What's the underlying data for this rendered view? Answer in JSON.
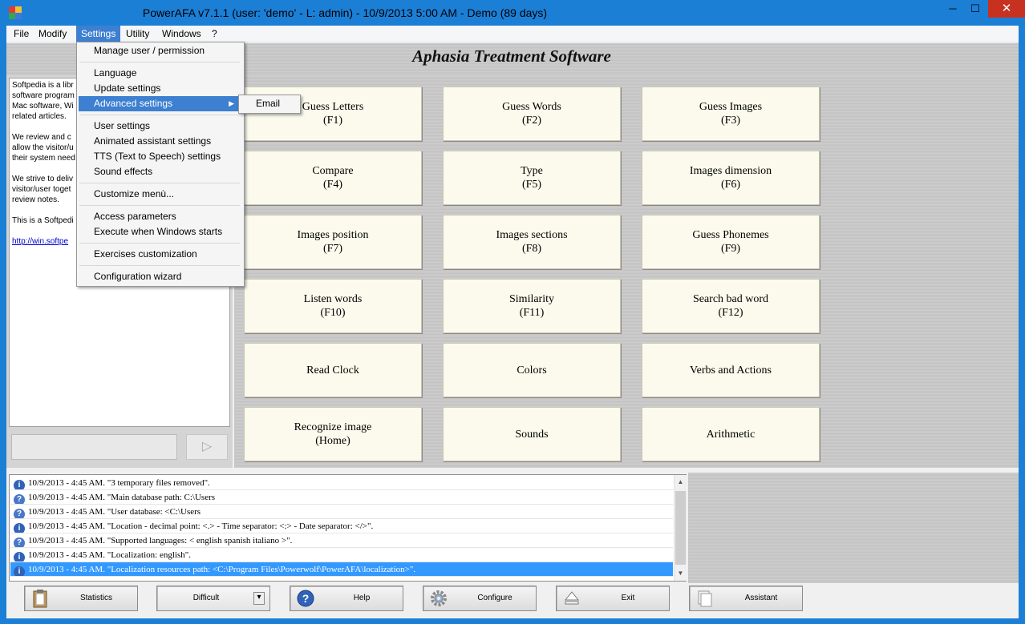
{
  "window": {
    "title": "PowerAFA v7.1.1  (user: 'demo'  - L: admin) - 10/9/2013 5:00 AM - Demo (89 days)",
    "minimize": "─",
    "maximize": "☐",
    "close": "✕"
  },
  "menubar": {
    "items": [
      "File",
      "Modify",
      "Settings",
      "Utility",
      "Windows",
      "?"
    ]
  },
  "header": {
    "title": "Aphasia Treatment Software"
  },
  "info_text": {
    "paragraphs": [
      "Softpedia is a libr\nsoftware program\nMac software, Wi\nrelated articles.",
      "We review and c\nallow the visitor/u\ntheir system need",
      "We strive to deliv\nvisitor/user toget\nreview notes.",
      "This is a Softpedi"
    ],
    "link": "http://win.softpe"
  },
  "play_button": "▷",
  "settings_menu": {
    "items": [
      "Manage user / permission",
      "Language",
      "Update settings",
      "Advanced settings",
      "User settings",
      "Animated assistant settings",
      "TTS (Text to Speech) settings",
      "Sound effects",
      "Customize  menù...",
      "Access parameters",
      "Execute when Windows starts",
      "Exercises customization",
      "Configuration wizard"
    ],
    "submenu_arrow": "▶",
    "submenu": [
      "Email"
    ]
  },
  "exercises": [
    {
      "name": "Guess Letters",
      "key": "(F1)"
    },
    {
      "name": "Guess Words",
      "key": "(F2)"
    },
    {
      "name": "Guess Images",
      "key": "(F3)"
    },
    {
      "name": "Compare",
      "key": "(F4)"
    },
    {
      "name": "Type",
      "key": "(F5)"
    },
    {
      "name": "Images dimension",
      "key": "(F6)"
    },
    {
      "name": "Images position",
      "key": "(F7)"
    },
    {
      "name": "Images sections",
      "key": "(F8)"
    },
    {
      "name": "Guess Phonemes",
      "key": "(F9)"
    },
    {
      "name": "Listen words",
      "key": "(F10)"
    },
    {
      "name": "Similarity",
      "key": "(F11)"
    },
    {
      "name": "Search bad word",
      "key": "(F12)"
    },
    {
      "name": "Read Clock",
      "key": ""
    },
    {
      "name": "Colors",
      "key": ""
    },
    {
      "name": "Verbs and Actions",
      "key": ""
    },
    {
      "name": "Recognize image",
      "key": "(Home)"
    },
    {
      "name": "Sounds",
      "key": ""
    },
    {
      "name": "Arithmetic",
      "key": ""
    }
  ],
  "log": {
    "rows": [
      {
        "icon": "i",
        "text": "10/9/2013 - 4:45 AM. \"3 temporary files removed\"."
      },
      {
        "icon": "?",
        "text": "10/9/2013 - 4:45 AM. \"Main database path: C:\\Users"
      },
      {
        "icon": "?",
        "text": "10/9/2013 - 4:45 AM. \"User database: <C:\\Users"
      },
      {
        "icon": "i",
        "text": "10/9/2013 - 4:45 AM. \"Location - decimal point: <.> - Time separator: <:> - Date separator: </>\"."
      },
      {
        "icon": "?",
        "text": "10/9/2013 - 4:45 AM. \"Supported languages: < english spanish italiano >\"."
      },
      {
        "icon": "i",
        "text": "10/9/2013 - 4:45 AM. \"Localization: english\"."
      },
      {
        "icon": "i",
        "text": "10/9/2013 - 4:45 AM. \"Localization resources path: <C:\\Program Files\\Powerwolf\\PowerAFA\\localization>\"."
      }
    ],
    "scroll_up": "▲",
    "scroll_down": "▼"
  },
  "bottom_buttons": {
    "statistics": "Statistics",
    "difficulty": "Difficult",
    "difficulty_arrow": "▾",
    "help": "Help",
    "configure": "Configure",
    "exit": "Exit",
    "assistant": "Assistant"
  },
  "colors": {
    "titlebar": "#1c7fd6",
    "menu_highlight": "#3d7fd0",
    "close_button": "#c7311f",
    "exercise_bg": "#fbfaec",
    "selected_log_row": "#3399ff"
  }
}
